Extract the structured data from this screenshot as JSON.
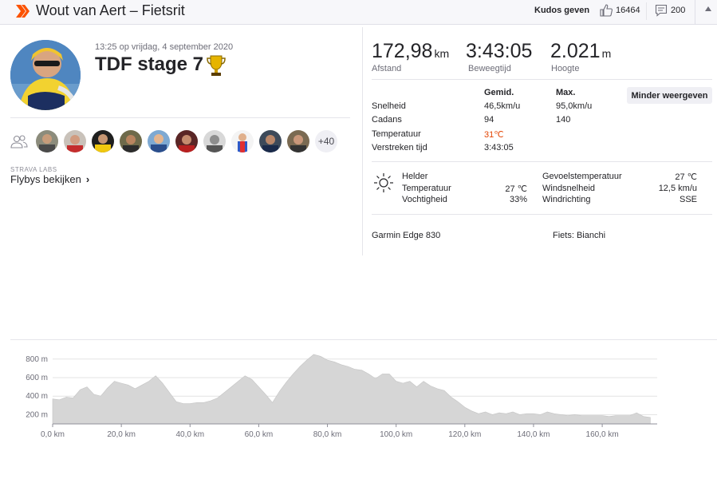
{
  "header": {
    "title": "Wout van Aert – Fietsrit",
    "kudos_button": "Kudos geven",
    "kudos_count": "16464",
    "comment_count": "200"
  },
  "activity": {
    "date": "13:25 op vrijdag, 4 september 2020",
    "title": "TDF stage 7",
    "more_athletes": "+40",
    "labs_label": "STRAVA LABS",
    "flybys": "Flybys bekijken"
  },
  "summary": [
    {
      "value": "172,98",
      "unit": "km",
      "label": "Afstand"
    },
    {
      "value": "3:43:05",
      "unit": "",
      "label": "Beweegtijd"
    },
    {
      "value": "2.021",
      "unit": "m",
      "label": "Hoogte"
    }
  ],
  "stats": {
    "col_avg": "Gemid.",
    "col_max": "Max.",
    "toggle_button": "Minder weergeven",
    "rows": [
      {
        "label": "Snelheid",
        "avg": "46,5km/u",
        "max": "95,0km/u"
      },
      {
        "label": "Cadans",
        "avg": "94",
        "max": "140"
      },
      {
        "label": "Temperatuur",
        "avg": "31℃",
        "max": ""
      },
      {
        "label": "Verstreken tijd",
        "avg": "3:43:05",
        "max": ""
      }
    ]
  },
  "weather": {
    "condition": "Helder",
    "temp_label": "Temperatuur",
    "temp_value": "27 ℃",
    "humidity_label": "Vochtigheid",
    "humidity_value": "33%",
    "feels_label": "Gevoelstemperatuur",
    "feels_value": "27 ℃",
    "wind_label": "Windsnelheid",
    "wind_value": "12,5 km/u",
    "dir_label": "Windrichting",
    "dir_value": "SSE"
  },
  "device": "Garmin Edge 830",
  "bike": "Fiets: Bianchi",
  "colors": {
    "brand": "#fc5200",
    "red_value": "#e34402",
    "elevation_fill": "#d6d6d6"
  },
  "chart_data": {
    "type": "area",
    "xlabel": "",
    "ylabel": "",
    "x_ticks": [
      "0,0 km",
      "20,0 km",
      "40,0 km",
      "60,0 km",
      "80,0 km",
      "100,0 km",
      "120,0 km",
      "140,0 km",
      "160,0 km"
    ],
    "y_ticks": [
      "200 m",
      "400 m",
      "600 m",
      "800 m"
    ],
    "xlim": [
      0,
      176
    ],
    "ylim": [
      100,
      850
    ],
    "grid": true,
    "x": [
      0,
      2,
      4,
      6,
      8,
      10,
      12,
      14,
      16,
      18,
      20,
      22,
      24,
      26,
      28,
      30,
      32,
      34,
      36,
      38,
      40,
      42,
      44,
      46,
      48,
      50,
      52,
      54,
      56,
      58,
      60,
      62,
      64,
      66,
      68,
      70,
      72,
      74,
      76,
      78,
      80,
      82,
      84,
      86,
      88,
      90,
      92,
      94,
      96,
      98,
      100,
      102,
      104,
      106,
      108,
      110,
      112,
      114,
      116,
      118,
      120,
      122,
      124,
      126,
      128,
      130,
      132,
      134,
      136,
      138,
      140,
      142,
      144,
      146,
      148,
      150,
      152,
      154,
      156,
      158,
      160,
      162,
      164,
      166,
      168,
      170,
      172,
      174
    ],
    "values": [
      370,
      360,
      390,
      380,
      470,
      500,
      420,
      400,
      490,
      560,
      540,
      520,
      480,
      520,
      560,
      620,
      540,
      440,
      340,
      320,
      320,
      330,
      330,
      350,
      380,
      440,
      500,
      560,
      620,
      580,
      500,
      420,
      330,
      450,
      550,
      640,
      720,
      790,
      850,
      830,
      790,
      770,
      740,
      720,
      690,
      680,
      640,
      590,
      640,
      640,
      560,
      540,
      560,
      500,
      560,
      510,
      480,
      460,
      390,
      340,
      280,
      240,
      210,
      230,
      200,
      220,
      210,
      230,
      200,
      210,
      210,
      200,
      230,
      210,
      200,
      190,
      200,
      190,
      190,
      190,
      190,
      180,
      190,
      190,
      190,
      220,
      180,
      170
    ]
  }
}
